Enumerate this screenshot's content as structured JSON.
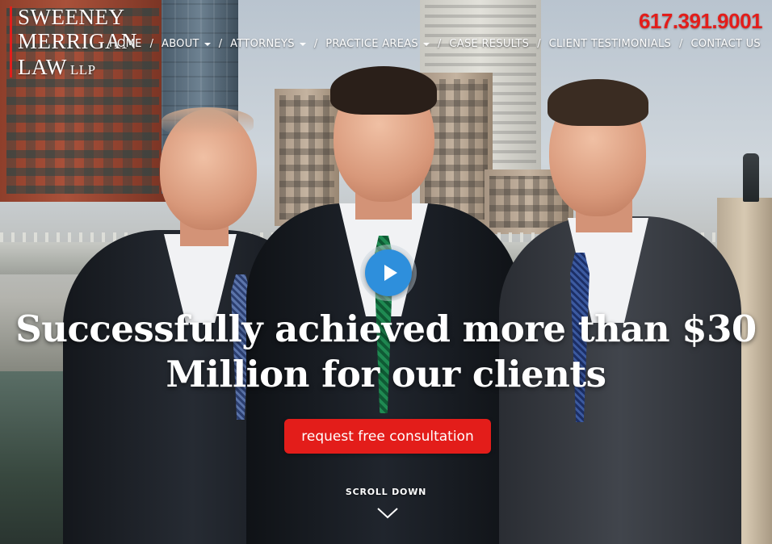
{
  "logo": {
    "line1": "SWEENEY",
    "line2": "MERRIGAN",
    "line3": "LAW",
    "suffix": "LLP"
  },
  "phone": "617.391.9001",
  "nav": {
    "items": [
      {
        "label": "HOME",
        "dropdown": false
      },
      {
        "label": "ABOUT",
        "dropdown": true
      },
      {
        "label": "ATTORNEYS",
        "dropdown": true
      },
      {
        "label": "PRACTICE AREAS",
        "dropdown": true
      },
      {
        "label": "CASE RESULTS",
        "dropdown": false
      },
      {
        "label": "CLIENT TESTIMONIALS",
        "dropdown": false
      },
      {
        "label": "CONTACT US",
        "dropdown": false
      }
    ],
    "separator": "/"
  },
  "hero": {
    "headline_line1": "Successfully achieved more than $30",
    "headline_line2": "Million for our clients",
    "cta_label": "request free consultation",
    "scroll_label": "SCROLL DOWN"
  },
  "icons": {
    "play": "play-icon",
    "scroll": "chevron-down-icon",
    "caret": "caret-down-icon"
  },
  "colors": {
    "accent": "#e31d1a",
    "play_button": "#2e8fdc",
    "text": "#ffffff"
  }
}
